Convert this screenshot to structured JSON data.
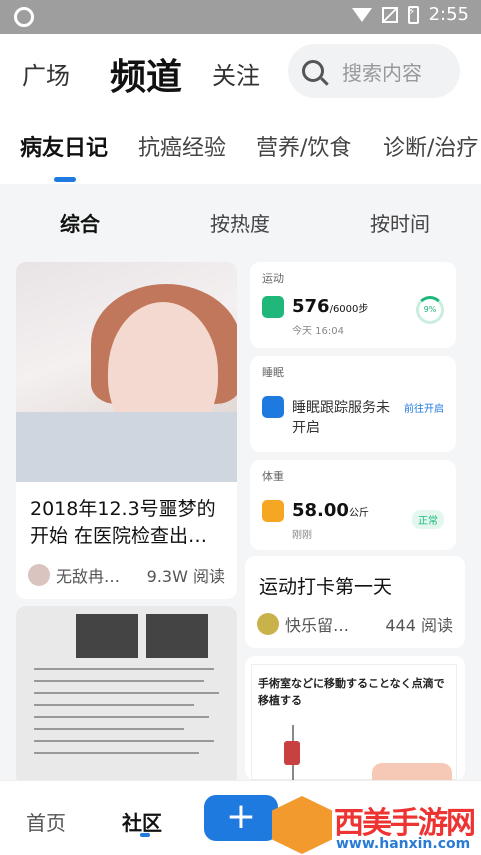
{
  "status_bar": {
    "time": "2:55"
  },
  "header": {
    "tabs": [
      "广场",
      "频道",
      "关注"
    ],
    "search_placeholder": "搜索内容"
  },
  "categories": [
    "病友日记",
    "抗癌经验",
    "营养/饮食",
    "诊断/治疗"
  ],
  "subtabs": [
    "综合",
    "按热度",
    "按时间"
  ],
  "feed": {
    "left": [
      {
        "title": "2018年12.3号噩梦的开始 在医院检查出…",
        "author": "无敌冉…",
        "reads": "9.3W 阅读"
      }
    ],
    "right": [
      {
        "title": "运动打卡第一天",
        "author": "快乐留…",
        "reads": "444 阅读"
      },
      {
        "title": "手術室などに移動することなく点滴で移植する"
      }
    ]
  },
  "health_widget": {
    "sport": {
      "label": "运动",
      "steps": "576",
      "goal": "/6000步",
      "time": "今天 16:04",
      "percent": "9%"
    },
    "sleep": {
      "label": "睡眠",
      "text": "睡眠跟踪服务未开启",
      "action": "前往开启"
    },
    "weight": {
      "label": "体重",
      "value": "58.00",
      "unit": "公斤",
      "sub": "刚刚",
      "status": "正常"
    }
  },
  "bottom_nav": {
    "home": "首页",
    "community": "社区",
    "plus": "+"
  },
  "watermark": {
    "text": "西美手游网",
    "url": "www.hanxin.com"
  }
}
